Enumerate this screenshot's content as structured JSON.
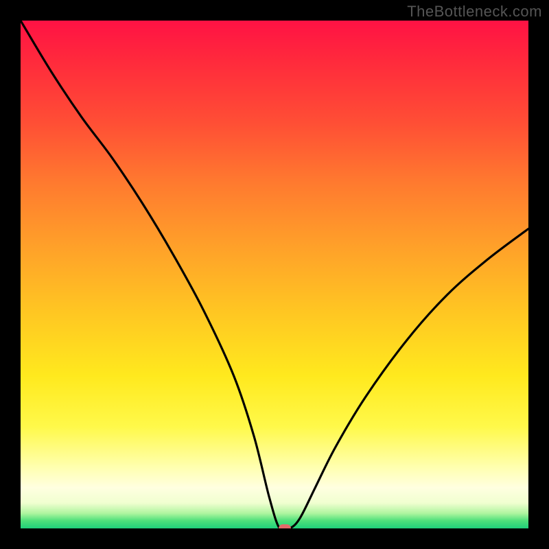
{
  "watermark": "TheBottleneck.com",
  "colors": {
    "background": "#000000",
    "curve": "#000000",
    "marker": "#e26a6a"
  },
  "chart_data": {
    "type": "line",
    "title": "",
    "xlabel": "",
    "ylabel": "",
    "xlim": [
      0,
      100
    ],
    "ylim": [
      0,
      100
    ],
    "grid": false,
    "x": [
      0,
      6,
      12,
      18,
      24,
      30,
      36,
      42,
      46,
      49,
      51,
      53,
      55,
      58,
      62,
      68,
      76,
      84,
      92,
      100
    ],
    "values": [
      100,
      90,
      81,
      73,
      64,
      54,
      43,
      30,
      18,
      6,
      0,
      0,
      2,
      8,
      16,
      26,
      37,
      46,
      53,
      59
    ],
    "marker": {
      "x": 52,
      "y": 0
    },
    "background_gradient": {
      "stops": [
        {
          "pos": 0.0,
          "color": "#ff1244"
        },
        {
          "pos": 0.2,
          "color": "#ff4e35"
        },
        {
          "pos": 0.45,
          "color": "#ffa229"
        },
        {
          "pos": 0.7,
          "color": "#ffe91e"
        },
        {
          "pos": 0.88,
          "color": "#ffffb0"
        },
        {
          "pos": 0.97,
          "color": "#b0f5a0"
        },
        {
          "pos": 1.0,
          "color": "#1fd07a"
        }
      ]
    }
  }
}
